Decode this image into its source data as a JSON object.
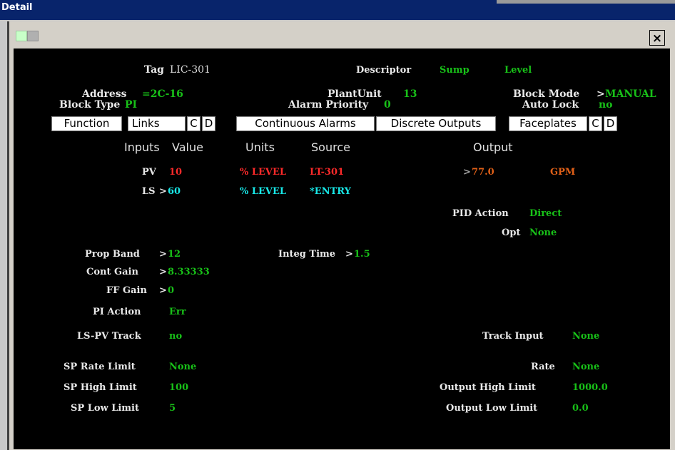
{
  "window": {
    "title": "Detail",
    "close_glyph": "×"
  },
  "tabs": {
    "function": "Function",
    "links": "Links",
    "links_c": "C",
    "links_d": "D",
    "continuous_alarms": "Continuous Alarms",
    "discrete_outputs": "Discrete Outputs",
    "faceplates": "Faceplates",
    "faceplates_c": "C",
    "faceplates_d": "D"
  },
  "header": {
    "tag_label": "Tag",
    "tag_value": "LIC-301",
    "descriptor_label": "Descriptor",
    "descriptor_value_1": "Sump",
    "descriptor_value_2": "Level",
    "address_label": "Address",
    "address_value": "=2C-16",
    "block_type_label": "Block Type",
    "block_type_value": "PI",
    "plant_unit_label": "PlantUnit",
    "plant_unit_value": "13",
    "alarm_priority_label": "Alarm Priority",
    "alarm_priority_value": "0",
    "block_mode_label": "Block Mode",
    "block_mode_value": "MANUAL",
    "auto_lock_label": "Auto Lock",
    "auto_lock_value": "no"
  },
  "columns": {
    "inputs": "Inputs",
    "value": "Value",
    "units": "Units",
    "source": "Source",
    "output": "Output"
  },
  "inputs": {
    "pv": {
      "label": "PV",
      "value": "10",
      "units": "% LEVEL",
      "source": "LT-301"
    },
    "ls": {
      "label": "LS",
      "value": "60",
      "units": "% LEVEL",
      "source": "*ENTRY"
    }
  },
  "output": {
    "value": "77.0",
    "units": "GPM"
  },
  "pid_action": {
    "label": "PID Action",
    "value": "Direct"
  },
  "opt": {
    "label": "Opt",
    "value": "None"
  },
  "params": {
    "prop_band": {
      "label": "Prop Band",
      "value": "12"
    },
    "integ_time": {
      "label": "Integ Time",
      "value": "1.5"
    },
    "cont_gain": {
      "label": "Cont Gain",
      "value": "8.33333"
    },
    "ff_gain": {
      "label": "FF Gain",
      "value": "0"
    },
    "pi_action": {
      "label": "PI Action",
      "value": "Err"
    },
    "ls_pv_track": {
      "label": "LS-PV Track",
      "value": "no"
    },
    "track_input": {
      "label": "Track Input",
      "value": "None"
    },
    "sp_rate_limit": {
      "label": "SP Rate Limit",
      "value": "None"
    },
    "rate": {
      "label": "Rate",
      "value": "None"
    },
    "sp_high_limit": {
      "label": "SP High Limit",
      "value": "100"
    },
    "output_high_limit": {
      "label": "Output High Limit",
      "value": "1000.0"
    },
    "sp_low_limit": {
      "label": "SP Low Limit",
      "value": "5"
    },
    "output_low_limit": {
      "label": "Output Low Limit",
      "value": "0.0"
    }
  },
  "arrow": ">",
  "colors": {
    "panel": "#000000",
    "label": "#e8e8e8",
    "value_green": "#18c018",
    "value_red": "#ff2a2a",
    "value_cyan": "#18e8e8",
    "value_orange": "#e06018",
    "title_bar": "#08246b"
  }
}
